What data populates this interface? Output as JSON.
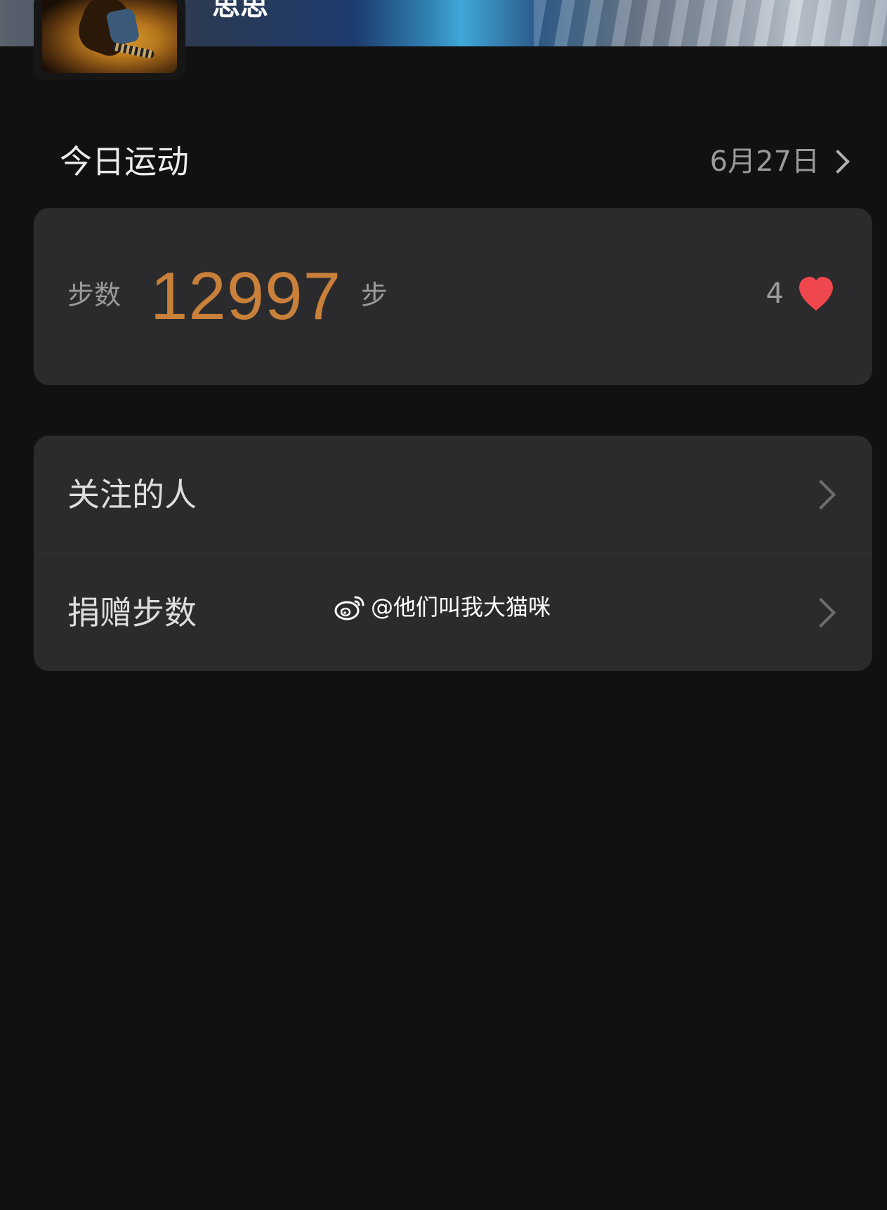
{
  "profile": {
    "username": "思思"
  },
  "today": {
    "title": "今日运动",
    "date": "6月27日"
  },
  "steps": {
    "label": "步数",
    "value": "12997",
    "unit": "步",
    "likes": "4"
  },
  "menu": {
    "items": [
      {
        "label": "关注的人"
      },
      {
        "label": "捐赠步数"
      }
    ]
  },
  "watermark": {
    "text": "@他们叫我大猫咪"
  },
  "colors": {
    "background": "#111111",
    "card": "#2b2b2d",
    "accent": "#c9803a",
    "heart": "#f0474f"
  },
  "icons": {
    "date_chevron": "chevron-right-icon",
    "like": "heart-icon",
    "menu_chevron": "chevron-right-icon",
    "watermark": "weibo-icon"
  }
}
